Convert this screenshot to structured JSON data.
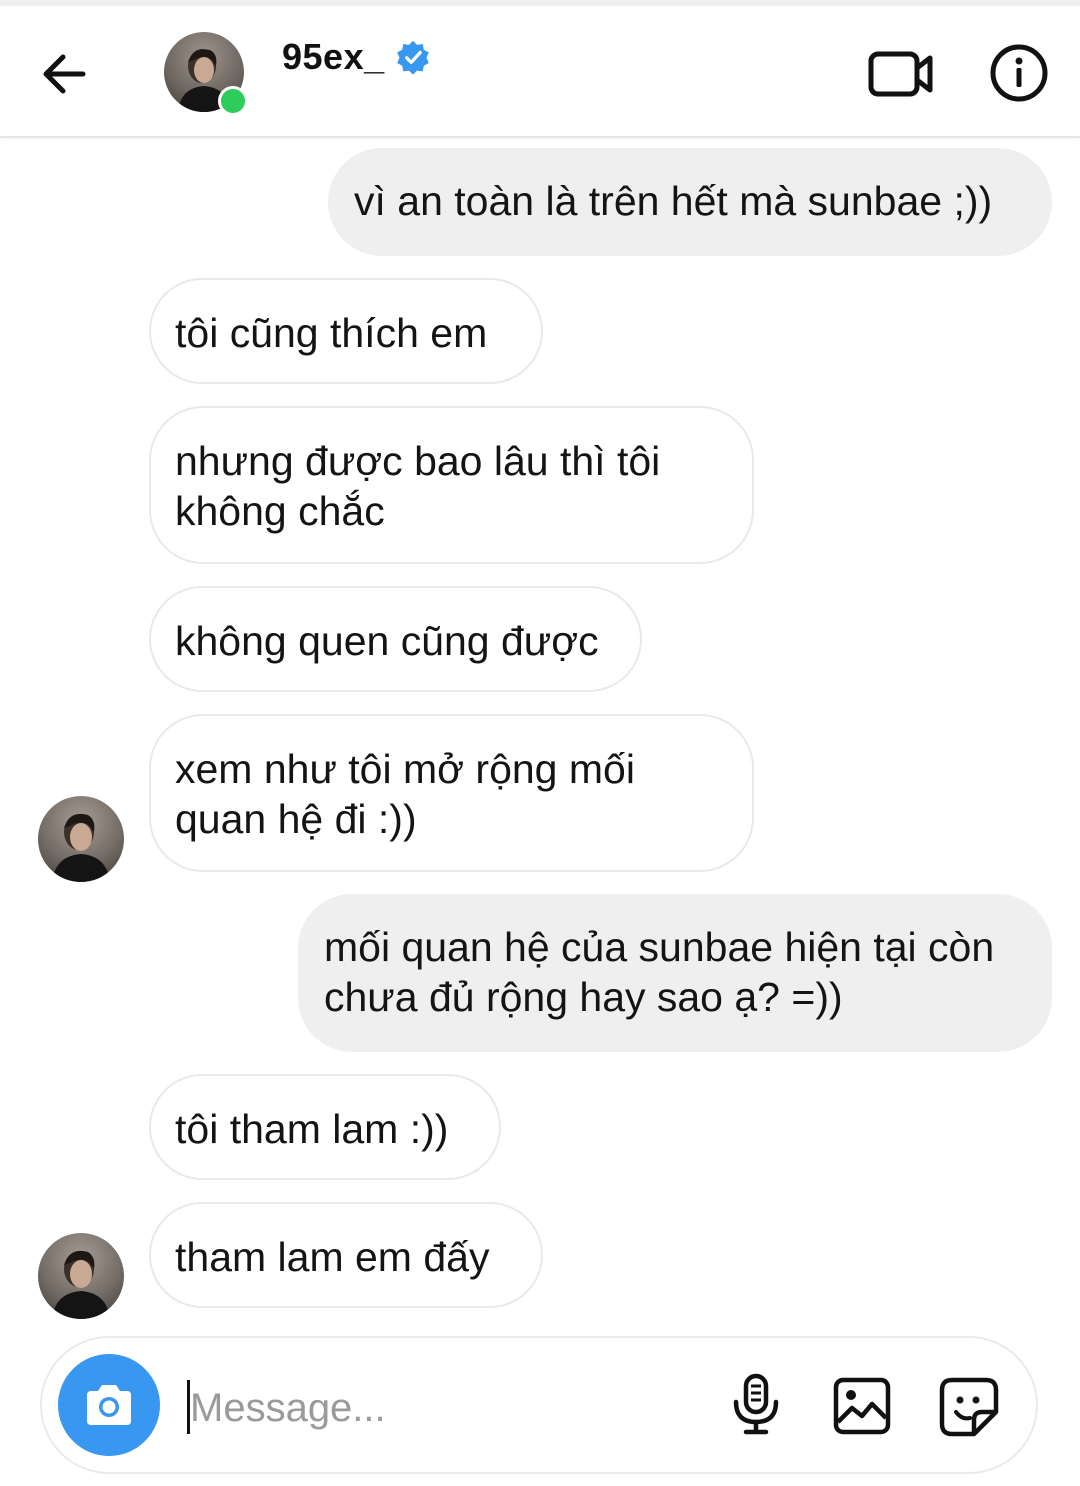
{
  "header": {
    "username": "95ex_",
    "verified": true,
    "online": true
  },
  "icons": {
    "back": "arrow-left-icon",
    "verified": "verified-badge-icon",
    "video": "video-call-icon",
    "info": "info-icon",
    "camera": "camera-icon",
    "mic": "microphone-icon",
    "gallery": "image-gallery-icon",
    "sticker": "sticker-icon"
  },
  "colors": {
    "accent": "#3897f0",
    "online": "#2ecc5a",
    "outgoing_bubble": "#efefef",
    "incoming_border": "#e9e9e9"
  },
  "messages": [
    {
      "direction": "outgoing",
      "lines": [
        "vì an toàn là trên hết mà sunbae ;))"
      ]
    },
    {
      "direction": "incoming",
      "lines": [
        "tôi cũng thích em"
      ]
    },
    {
      "direction": "incoming",
      "lines": [
        "nhưng được bao lâu thì tôi",
        "không chắc"
      ]
    },
    {
      "direction": "incoming",
      "lines": [
        "không quen cũng được"
      ]
    },
    {
      "direction": "incoming",
      "lines": [
        "xem như tôi mở rộng mối",
        "quan hệ đi :))"
      ]
    },
    {
      "direction": "outgoing",
      "lines": [
        "mối quan hệ của sunbae hiện tại còn",
        "chưa đủ rộng hay sao ạ? =))"
      ]
    },
    {
      "direction": "incoming",
      "lines": [
        "tôi tham lam :))"
      ]
    },
    {
      "direction": "incoming",
      "lines": [
        "tham lam em đấy"
      ]
    }
  ],
  "composer": {
    "placeholder": "Message...",
    "value": ""
  }
}
